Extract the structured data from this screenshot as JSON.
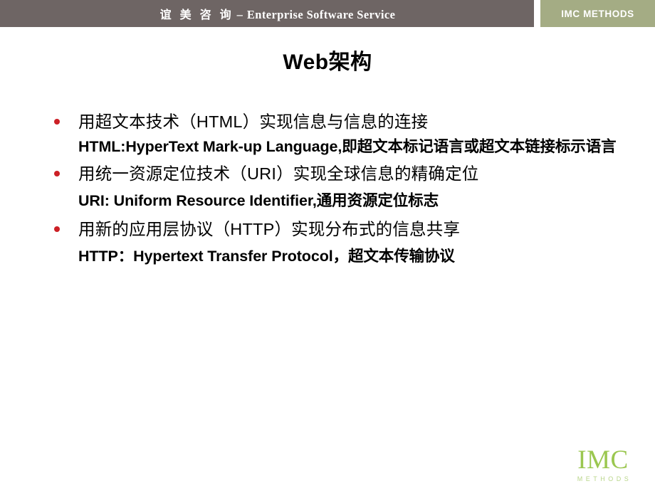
{
  "header": {
    "company_cn": "谊 美 咨 询",
    "dash": "–",
    "company_en": "Enterprise Software Service",
    "badge_label": "IMC METHODS",
    "bar_color": "#6e6564",
    "badge_color": "#a4ac84"
  },
  "slide": {
    "title": "Web架构",
    "bullet_color": "#cc2026",
    "bullets": [
      {
        "main": "用超文本技术（HTML）实现信息与信息的连接",
        "sub": "HTML:HyperText Mark-up Language,即超文本标记语言或超文本链接标示语言"
      },
      {
        "main": "用统一资源定位技术（URI）实现全球信息的精确定位",
        "sub": "URI: Uniform Resource Identifier,通用资源定位标志"
      },
      {
        "main": "用新的应用层协议（HTTP）实现分布式的信息共享",
        "sub": "HTTP：Hypertext Transfer Protocol，超文本传输协议"
      }
    ]
  },
  "footer": {
    "logo_text": "IMC",
    "logo_subtext": "METHODS",
    "logo_color": "#9bc750"
  }
}
